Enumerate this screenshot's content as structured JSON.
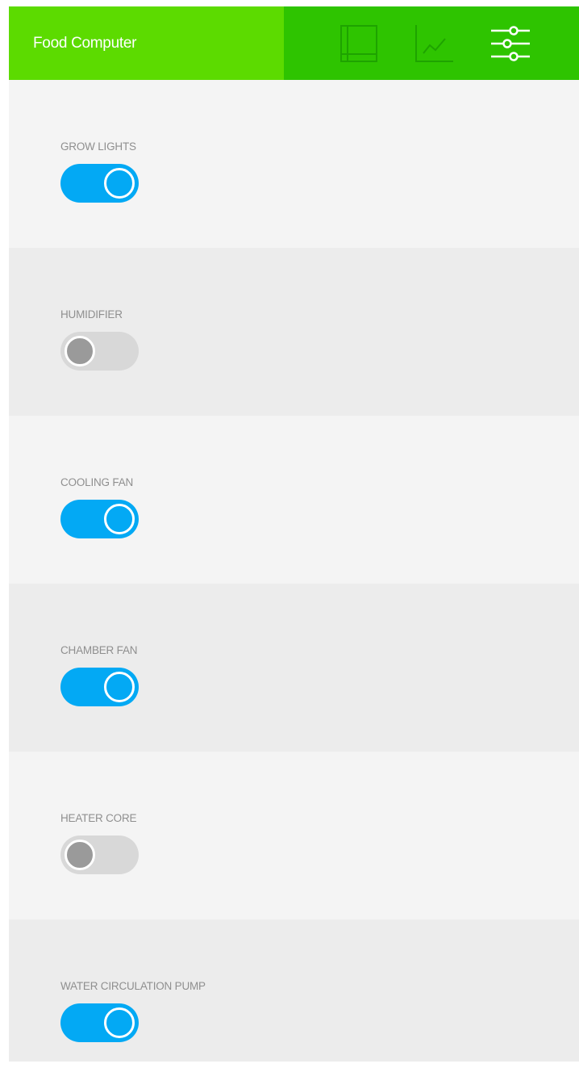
{
  "app": {
    "title": "Food Computer"
  },
  "nav": {
    "items": [
      {
        "icon": "layout-icon",
        "active": false
      },
      {
        "icon": "line-chart-icon",
        "active": false
      },
      {
        "icon": "sliders-icon",
        "active": true
      }
    ]
  },
  "controls": [
    {
      "label": "GROW LIGHTS",
      "on": true
    },
    {
      "label": "HUMIDIFIER",
      "on": false
    },
    {
      "label": "COOLING FAN",
      "on": true
    },
    {
      "label": "CHAMBER FAN",
      "on": true
    },
    {
      "label": "HEATER CORE",
      "on": false
    },
    {
      "label": "WATER CIRCULATION PUMP",
      "on": true
    }
  ],
  "colors": {
    "title_bar": "#5cdb00",
    "nav_bar": "#2ec400",
    "toggle_on": "#03a9f4",
    "toggle_off": "#d8d8d8",
    "knob_off": "#9a9a9a",
    "inactive_icon": "#1ea300",
    "active_icon": "#ffffff"
  }
}
